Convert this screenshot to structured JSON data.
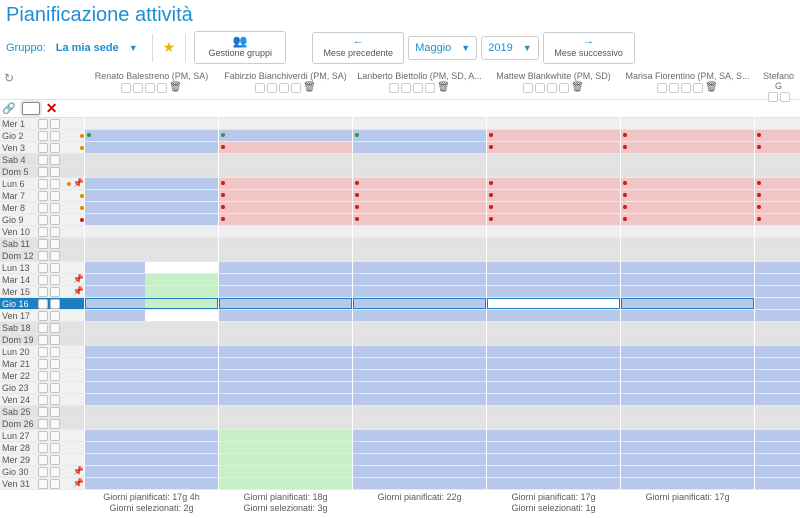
{
  "title": "Pianificazione attività",
  "toolbar": {
    "group_label": "Gruppo:",
    "group_value": "La mia sede",
    "manage_groups": "Gestione gruppi",
    "prev_month": "Mese precedente",
    "next_month": "Mese successivo",
    "month": "Maggio",
    "year": "2019"
  },
  "people": [
    {
      "name": "Renato Balestreno (PM, SA)",
      "foot_plan": "Giorni pianificati: 17g 4h",
      "foot_sel": "Giorni selezionati: 2g"
    },
    {
      "name": "Fabirzio Bianchiverdi (PM, SA)",
      "foot_plan": "Giorni pianificati: 18g",
      "foot_sel": "Giorni selezionati: 3g"
    },
    {
      "name": "Lanberto Biettollo (PM, SD, A...",
      "foot_plan": "Giorni pianificati: 22g",
      "foot_sel": ""
    },
    {
      "name": "Mattew Blankwhite (PM, SD)",
      "foot_plan": "Giorni pianificati: 17g",
      "foot_sel": "Giorni selezionati: 1g"
    },
    {
      "name": "Marisa Fiorentino (PM, SA, S...",
      "foot_plan": "Giorni pianificati: 17g",
      "foot_sel": ""
    }
  ],
  "extra_person": "Stefano G",
  "days": [
    {
      "lbl": "Mer 1",
      "cls": "df",
      "pin": false,
      "dot": ""
    },
    {
      "lbl": "Gio 2",
      "cls": "df",
      "pin": false,
      "dot": "o"
    },
    {
      "lbl": "Ven 3",
      "cls": "df",
      "pin": false,
      "dot": "o"
    },
    {
      "lbl": "Sab 4",
      "cls": "weekend",
      "pin": false,
      "dot": ""
    },
    {
      "lbl": "Dom 5",
      "cls": "weekend",
      "pin": false,
      "dot": ""
    },
    {
      "lbl": "Lun 6",
      "cls": "df",
      "pin": true,
      "dot": "o"
    },
    {
      "lbl": "Mar 7",
      "cls": "df",
      "pin": false,
      "dot": "o"
    },
    {
      "lbl": "Mer 8",
      "cls": "df",
      "pin": false,
      "dot": "o"
    },
    {
      "lbl": "Gio 9",
      "cls": "df",
      "pin": false,
      "dot": "r"
    },
    {
      "lbl": "Ven 10",
      "cls": "df",
      "pin": false,
      "dot": ""
    },
    {
      "lbl": "Sab 11",
      "cls": "weekend",
      "pin": false,
      "dot": ""
    },
    {
      "lbl": "Dom 12",
      "cls": "weekend",
      "pin": false,
      "dot": ""
    },
    {
      "lbl": "Lun 13",
      "cls": "df",
      "pin": false,
      "dot": ""
    },
    {
      "lbl": "Mar 14",
      "cls": "df",
      "pin": true,
      "dot": ""
    },
    {
      "lbl": "Mer 15",
      "cls": "df",
      "pin": true,
      "dot": ""
    },
    {
      "lbl": "Gio 16",
      "cls": "sel",
      "pin": false,
      "dot": ""
    },
    {
      "lbl": "Ven 17",
      "cls": "df",
      "pin": false,
      "dot": ""
    },
    {
      "lbl": "Sab 18",
      "cls": "weekend",
      "pin": false,
      "dot": ""
    },
    {
      "lbl": "Dom 19",
      "cls": "weekend",
      "pin": false,
      "dot": ""
    },
    {
      "lbl": "Lun 20",
      "cls": "df",
      "pin": false,
      "dot": ""
    },
    {
      "lbl": "Mar 21",
      "cls": "df",
      "pin": false,
      "dot": ""
    },
    {
      "lbl": "Mer 22",
      "cls": "df",
      "pin": false,
      "dot": ""
    },
    {
      "lbl": "Gio 23",
      "cls": "df",
      "pin": false,
      "dot": ""
    },
    {
      "lbl": "Ven 24",
      "cls": "df",
      "pin": false,
      "dot": ""
    },
    {
      "lbl": "Sab 25",
      "cls": "weekend",
      "pin": false,
      "dot": ""
    },
    {
      "lbl": "Dom 26",
      "cls": "weekend",
      "pin": false,
      "dot": ""
    },
    {
      "lbl": "Lun 27",
      "cls": "df",
      "pin": false,
      "dot": ""
    },
    {
      "lbl": "Mar 28",
      "cls": "df",
      "pin": false,
      "dot": ""
    },
    {
      "lbl": "Mer 29",
      "cls": "df",
      "pin": false,
      "dot": ""
    },
    {
      "lbl": "Gio 30",
      "cls": "df",
      "pin": true,
      "dot": ""
    },
    {
      "lbl": "Ven 31",
      "cls": "df",
      "pin": true,
      "dot": ""
    }
  ],
  "grid": {
    "p0": [
      "lgrey",
      "blue:g",
      "blue",
      "grey",
      "grey",
      "blue",
      "blue",
      "blue",
      "blue",
      "lgrey",
      "grey",
      "grey",
      "split-bw",
      "split-bg",
      "split-bg",
      "split-bg:sel",
      "split-bw",
      "grey",
      "grey",
      "blue",
      "blue",
      "blue",
      "blue",
      "blue",
      "grey",
      "grey",
      "blue",
      "blue",
      "blue",
      "blue",
      "blue"
    ],
    "p1": [
      "lgrey",
      "blue:g",
      "pink:r",
      "grey",
      "grey",
      "pink:r",
      "pink:r",
      "pink:r",
      "pink:r",
      "lgrey",
      "grey",
      "grey",
      "blue",
      "blue",
      "blue",
      "blue:sel",
      "blue",
      "grey",
      "grey",
      "blue",
      "blue",
      "blue",
      "blue",
      "blue",
      "grey",
      "grey",
      "green",
      "green",
      "green",
      "green",
      "green"
    ],
    "p2": [
      "lgrey",
      "blue:g",
      "blue",
      "grey",
      "grey",
      "pink:r",
      "pink:r",
      "pink:r",
      "pink:r",
      "lgrey",
      "grey",
      "grey",
      "blue",
      "blue",
      "blue",
      "blue:sel",
      "blue",
      "grey",
      "grey",
      "blue",
      "blue",
      "blue",
      "blue",
      "blue",
      "grey",
      "grey",
      "blue",
      "blue",
      "blue",
      "blue",
      "blue"
    ],
    "p3": [
      "lgrey",
      "pink:r",
      "pink:r",
      "grey",
      "grey",
      "pink:r",
      "pink:r",
      "pink:r",
      "pink:r",
      "lgrey",
      "grey",
      "grey",
      "blue",
      "blue",
      "blue",
      "white:sel",
      "blue",
      "grey",
      "grey",
      "blue",
      "blue",
      "blue",
      "blue",
      "blue",
      "grey",
      "grey",
      "blue",
      "blue",
      "blue",
      "blue",
      "blue"
    ],
    "p4": [
      "lgrey",
      "pink:r",
      "pink:r",
      "grey",
      "grey",
      "pink:r",
      "pink:r",
      "pink:r",
      "pink:r",
      "lgrey",
      "grey",
      "grey",
      "blue",
      "blue",
      "blue",
      "blue:sel",
      "blue",
      "grey",
      "grey",
      "blue",
      "blue",
      "blue",
      "blue",
      "blue",
      "grey",
      "grey",
      "blue",
      "blue",
      "blue",
      "blue",
      "blue"
    ]
  }
}
